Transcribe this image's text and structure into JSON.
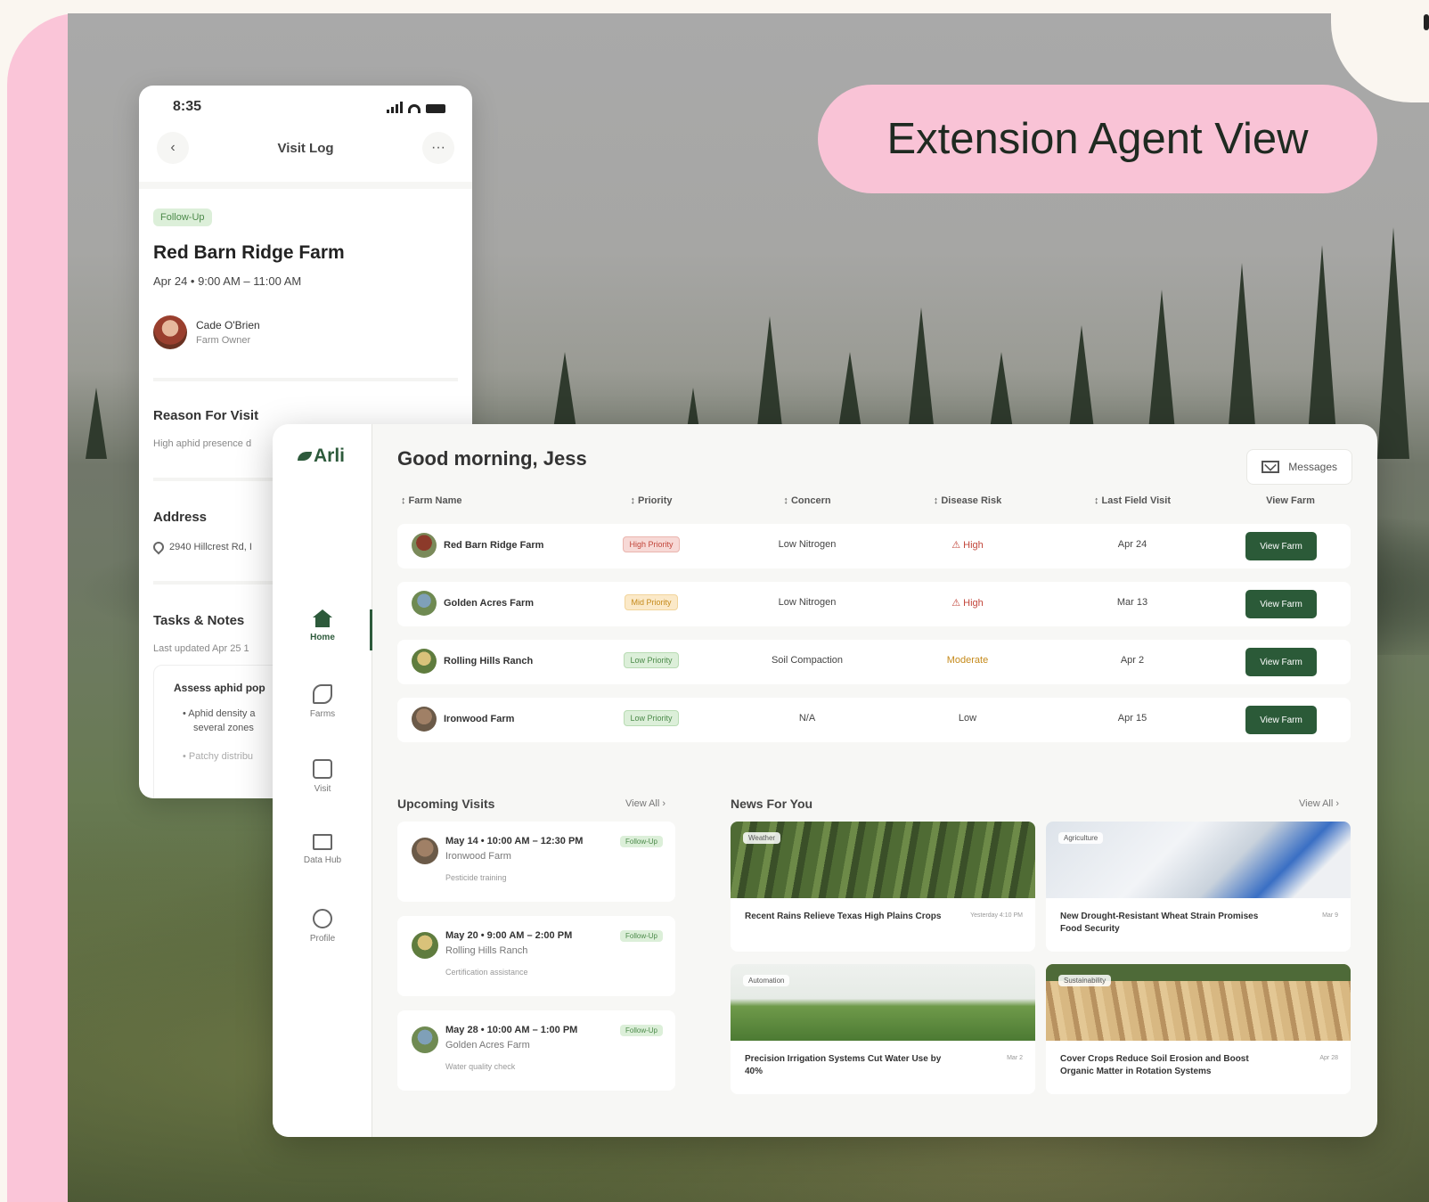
{
  "header": {
    "title": "Extension Agent View"
  },
  "phone": {
    "time": "8:35",
    "nav_title": "Visit Log",
    "back_glyph": "‹",
    "more_glyph": "···",
    "status_badge": "Follow-Up",
    "farm_name": "Red Barn Ridge Farm",
    "visit_time": "Apr 24 • 9:00 AM  –  11:00 AM",
    "contact": {
      "name": "Cade O'Brien",
      "role": "Farm Owner"
    },
    "reason_title": "Reason For Visit",
    "reason_text": "High aphid presence d",
    "address_title": "Address",
    "address_text": "2940 Hillcrest Rd, I",
    "tasks_title": "Tasks & Notes",
    "tasks_updated": "Last updated Apr 25 1",
    "task_heading": "Assess aphid pop",
    "task_bullets": [
      "•  Aphid density a",
      "several zones",
      "•  Patchy distribu"
    ]
  },
  "dashboard": {
    "logo": "Arli",
    "greeting": "Good morning, Jess",
    "messages_label": "Messages",
    "nav": [
      {
        "label": "Home",
        "icon": "home-icon"
      },
      {
        "label": "Farms",
        "icon": "farms-icon"
      },
      {
        "label": "Visit",
        "icon": "visit-icon"
      },
      {
        "label": "Data Hub",
        "icon": "data-hub-icon"
      },
      {
        "label": "Profile",
        "icon": "profile-icon"
      }
    ],
    "table": {
      "headers": [
        "↕ Farm Name",
        "↕ Priority",
        "↕ Concern",
        "↕ Disease Risk",
        "↕ Last Field Visit",
        "View Farm"
      ],
      "rows": [
        {
          "farm": "Red Barn Ridge Farm",
          "priority": "High Priority",
          "concern": "Low Nitrogen",
          "risk": "⚠ High",
          "last": "Apr 24",
          "action": "View Farm"
        },
        {
          "farm": "Golden Acres Farm",
          "priority": "Mid Priority",
          "concern": "Low Nitrogen",
          "risk": "⚠ High",
          "last": "Mar 13",
          "action": "View Farm"
        },
        {
          "farm": "Rolling Hills Ranch",
          "priority": "Low Priority",
          "concern": "Soil Compaction",
          "risk": "Moderate",
          "last": "Apr 2",
          "action": "View Farm"
        },
        {
          "farm": "Ironwood Farm",
          "priority": "Low Priority",
          "concern": "N/A",
          "risk": "Low",
          "last": "Apr 15",
          "action": "View Farm"
        }
      ]
    },
    "upcoming": {
      "title": "Upcoming Visits",
      "view_all": "View All  ›",
      "items": [
        {
          "when": "May 14 • 10:00 AM – 12:30 PM",
          "farm": "Ironwood Farm",
          "note": "Pesticide training",
          "badge": "Follow-Up"
        },
        {
          "when": "May 20 • 9:00 AM – 2:00 PM",
          "farm": "Rolling Hills Ranch",
          "note": "Certification assistance",
          "badge": "Follow-Up"
        },
        {
          "when": "May 28 • 10:00 AM – 1:00 PM",
          "farm": "Golden Acres Farm",
          "note": "Water quality check",
          "badge": "Follow-Up"
        }
      ]
    },
    "news": {
      "title": "News For You",
      "view_all": "View All  ›",
      "items": [
        {
          "tag": "Weather",
          "title": "Recent Rains Relieve Texas High Plains Crops",
          "date": "Yesterday 4:10 PM"
        },
        {
          "tag": "Agriculture",
          "title": "New Drought-Resistant Wheat Strain Promises Food Security",
          "date": "Mar 9"
        },
        {
          "tag": "Automation",
          "title": "Precision Irrigation Systems Cut Water Use by 40%",
          "date": "Mar 2"
        },
        {
          "tag": "Sustainability",
          "title": "Cover Crops Reduce Soil Erosion and Boost Organic Matter in Rotation Systems",
          "date": "Apr 28"
        }
      ]
    }
  },
  "colors": {
    "brand_green": "#2b5a38",
    "pink_accent": "#f9c3d6",
    "high_priority_bg": "#f7d9d6",
    "high_priority_text": "#c2463b",
    "mid_priority_bg": "#fbe9c8",
    "mid_priority_text": "#c58a1b",
    "low_priority_bg": "#dcefd9",
    "low_priority_text": "#4c8a4a"
  }
}
